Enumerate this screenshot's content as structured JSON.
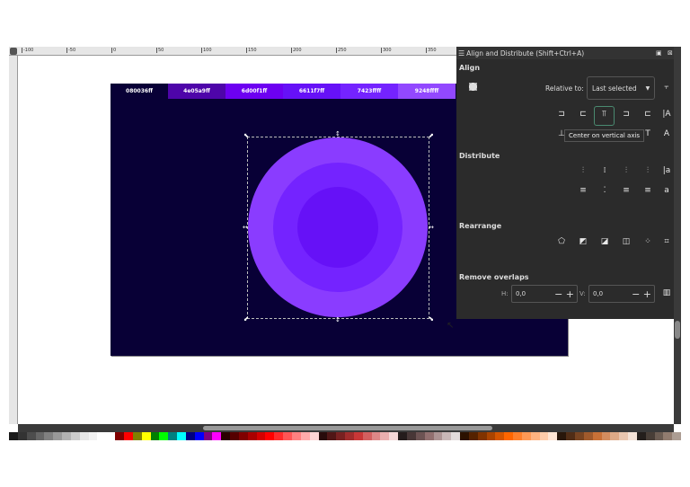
{
  "ruler": {
    "labels": [
      "-100",
      "-50",
      "0",
      "50",
      "100",
      "150",
      "200",
      "250",
      "300",
      "350"
    ]
  },
  "swatches": [
    {
      "label": "080036ff",
      "color": "#080036"
    },
    {
      "label": "4e05a9ff",
      "color": "#4e05a9"
    },
    {
      "label": "6d00f1ff",
      "color": "#6d00f1"
    },
    {
      "label": "6611f7ff",
      "color": "#6611f7"
    },
    {
      "label": "7423ffff",
      "color": "#7423ff"
    },
    {
      "label": "9248ffff",
      "color": "#9248ff"
    }
  ],
  "circles": {
    "outer": "#8a3cff",
    "middle": "#7423ff",
    "inner": "#6611f7"
  },
  "dialog": {
    "title": "Align and Distribute (Shift+Ctrl+A)",
    "align_heading": "Align",
    "relative_to_label": "Relative to:",
    "relative_to_value": "Last selected",
    "tooltip": "Center on vertical axis",
    "distribute_heading": "Distribute",
    "rearrange_heading": "Rearrange",
    "remove_overlaps_heading": "Remove overlaps",
    "h_label": "H:",
    "h_value": "0,0",
    "v_label": "V:",
    "v_value": "0,0"
  },
  "palette": [
    "#1a1a1a",
    "#333",
    "#4d4d4d",
    "#666",
    "#808080",
    "#999",
    "#b3b3b3",
    "#ccc",
    "#e6e6e6",
    "#f2f2f2",
    "#fff",
    "#fff",
    "#800000",
    "#ff0000",
    "#808000",
    "#ffff00",
    "#008000",
    "#00ff00",
    "#008080",
    "#00ffff",
    "#000080",
    "#0000ff",
    "#800080",
    "#ff00ff",
    "#2b0000",
    "#550000",
    "#800000",
    "#aa0000",
    "#d40000",
    "#ff0000",
    "#ff2a2a",
    "#ff5555",
    "#ff8080",
    "#ffaaaa",
    "#ffd5d5",
    "#280b0b",
    "#501616",
    "#782121",
    "#a02c2c",
    "#c83737",
    "#d35f5f",
    "#de8787",
    "#e9afaf",
    "#f4d7d7",
    "#241c1c",
    "#483737",
    "#6c5353",
    "#916f6f",
    "#ac9393",
    "#c8b7b7",
    "#e3dbdb",
    "#2b1100",
    "#552200",
    "#803300",
    "#aa4400",
    "#d45500",
    "#ff6600",
    "#ff7f2a",
    "#ff9955",
    "#ffb380",
    "#ffccaa",
    "#ffe6d5",
    "#28170b",
    "#502d16",
    "#784421",
    "#a05a2c",
    "#c87137",
    "#d38d5f",
    "#deaa87",
    "#e9c6af",
    "#f4e3d7",
    "#241f1c",
    "#483e37",
    "#6c5d53",
    "#917c6f",
    "#ac9d93"
  ]
}
